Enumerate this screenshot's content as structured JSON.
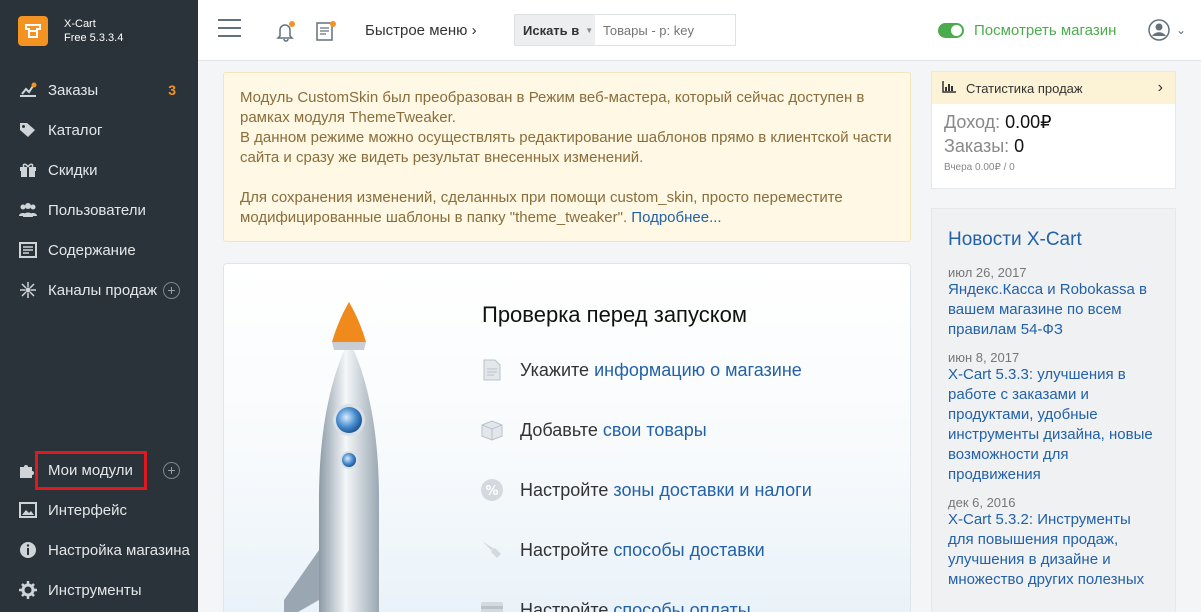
{
  "brand": {
    "name": "X-Cart",
    "version": "Free 5.3.3.4",
    "logo_color": "#f39422"
  },
  "sidebar": {
    "items": [
      {
        "label": "Заказы",
        "icon": "orders-icon",
        "badge": "3"
      },
      {
        "label": "Каталог",
        "icon": "tag-icon"
      },
      {
        "label": "Скидки",
        "icon": "gift-icon"
      },
      {
        "label": "Пользователи",
        "icon": "users-icon"
      },
      {
        "label": "Содержание",
        "icon": "content-icon"
      },
      {
        "label": "Каналы продаж",
        "icon": "channels-icon"
      },
      {
        "label": "Мои модули",
        "icon": "puzzle-icon"
      },
      {
        "label": "Интерфейс",
        "icon": "image-icon"
      },
      {
        "label": "Настройка магазина",
        "icon": "info-icon"
      },
      {
        "label": "Инструменты",
        "icon": "gear-icon"
      }
    ],
    "highlight_color": "#e0181f"
  },
  "header": {
    "quick_menu": "Быстрое меню",
    "search_select": "Искать в",
    "search_placeholder": "Товары - p: key",
    "view_store": "Посмотреть магазин",
    "accent": "#4bac4d"
  },
  "notice": {
    "line1": "Модуль CustomSkin был преобразован в Режим веб-мастера, который сейчас доступен в рамках модуля ThemeTweaker.",
    "line2": "В данном режиме можно осуществлять редактирование шаблонов прямо в клиентской части сайта и сразу же видеть результат внесенных изменений.",
    "line3": "Для сохранения изменений, сделанных при помощи custom_skin, просто переместите модифицированные шаблоны в папку \"theme_tweaker\".",
    "more_link": "Подробнее..."
  },
  "checklist": {
    "title": "Проверка перед запуском",
    "items": [
      {
        "prefix": "Укажите ",
        "link": "информацию о магазине",
        "icon": "document-icon"
      },
      {
        "prefix": "Добавьте ",
        "link": "свои товары",
        "icon": "box-icon"
      },
      {
        "prefix": "Настройте ",
        "link": "зоны доставки и налоги",
        "icon": "percent-icon"
      },
      {
        "prefix": "Настройте ",
        "link": "способы доставки",
        "icon": "shipping-icon"
      },
      {
        "prefix": "Настройте ",
        "link": "способы оплаты",
        "icon": "card-icon"
      }
    ]
  },
  "stats": {
    "title": "Статистика продаж",
    "income_label": "Доход:",
    "income_value": "0.00₽",
    "orders_label": "Заказы:",
    "orders_value": "0",
    "yesterday": "Вчера 0.00₽ / 0"
  },
  "news": {
    "title": "Новости X-Cart",
    "items": [
      {
        "date": "июл 26, 2017",
        "text": "Яндекс.Касса и Robokassa в вашем магазине по всем правилам 54-ФЗ"
      },
      {
        "date": "июн 8, 2017",
        "text": "X-Cart 5.3.3: улучшения в работе с заказами и продуктами, удобные инструменты дизайна, новые возможности для продвижения"
      },
      {
        "date": "дек 6, 2016",
        "text": "X-Cart 5.3.2: Инструменты для повышения продаж, улучшения в дизайне и множество других полезных"
      }
    ]
  }
}
